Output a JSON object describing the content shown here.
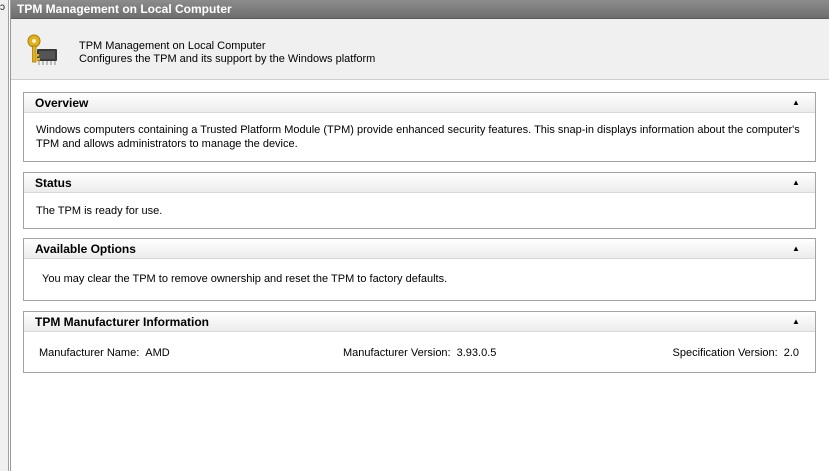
{
  "left_glyph": "ɔ",
  "window": {
    "title": "TPM Management on Local Computer"
  },
  "header": {
    "icon": "key-chip-icon",
    "title": "TPM Management on Local Computer",
    "subtitle": "Configures the TPM and its support by the Windows platform"
  },
  "collapse_glyph": "▲",
  "panels": {
    "overview": {
      "title": "Overview",
      "text": "Windows computers containing a Trusted Platform Module (TPM) provide enhanced security features. This snap-in displays information about the computer's TPM and allows administrators to manage the device."
    },
    "status": {
      "title": "Status",
      "text": "The TPM is ready for use."
    },
    "options": {
      "title": "Available Options",
      "text": "You may clear the TPM to remove ownership and reset the TPM to factory defaults."
    },
    "manufacturer": {
      "title": "TPM Manufacturer Information",
      "name_label": "Manufacturer Name:",
      "name_value": "AMD",
      "version_label": "Manufacturer Version:",
      "version_value": "3.93.0.5",
      "spec_label": "Specification Version:",
      "spec_value": "2.0"
    }
  },
  "colors": {
    "titlebar": "#7a7a7a",
    "header_bg": "#f0f0f0",
    "panel_border": "#a3a3a3"
  }
}
